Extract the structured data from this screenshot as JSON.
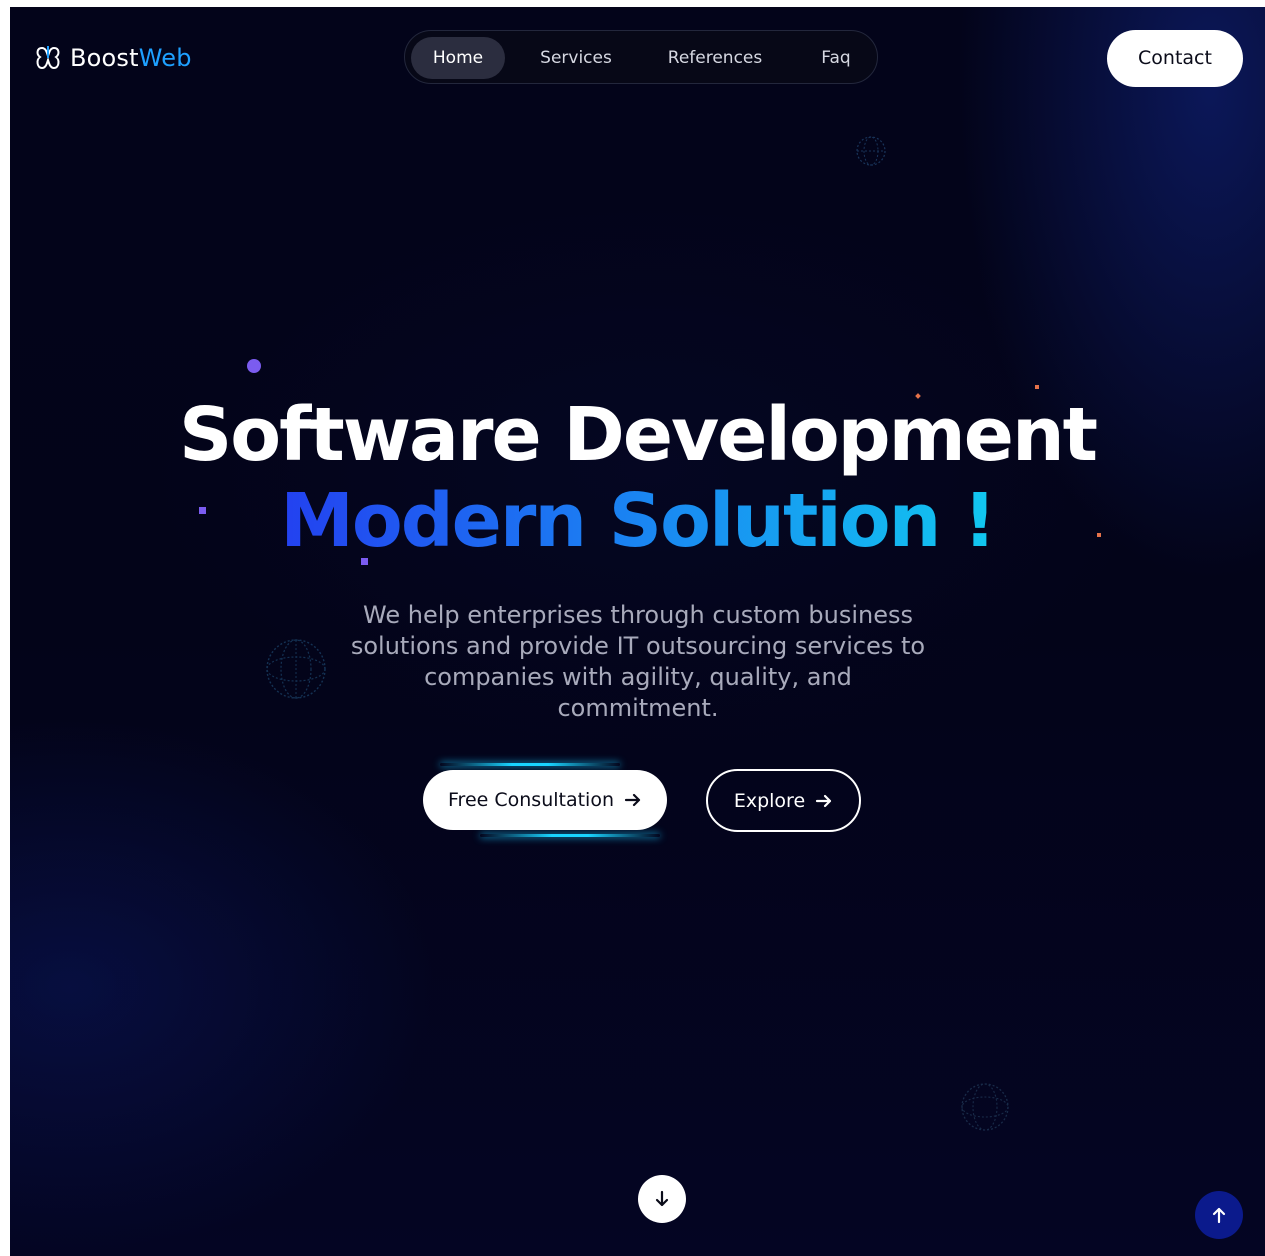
{
  "brand": {
    "name_part1": "Boost",
    "name_part2": "Web",
    "accent_color": "#1ea0ff"
  },
  "nav": {
    "items": [
      {
        "label": "Home",
        "active": true
      },
      {
        "label": "Services",
        "active": false
      },
      {
        "label": "References",
        "active": false
      },
      {
        "label": "Faq",
        "active": false
      }
    ],
    "contact_label": "Contact"
  },
  "hero": {
    "title": "Software Development",
    "subtitle": "Modern Solution !",
    "description": "We help enterprises through custom business solutions and provide IT outsourcing services to companies with agility, quality, and commitment.",
    "primary_button": "Free Consultation",
    "secondary_button": "Explore"
  },
  "icons": {
    "logo": "brand-logo-icon",
    "primary_button_arrow": "arrow-right-icon",
    "secondary_button_arrow": "arrow-right-icon",
    "scroll_down": "arrow-down-icon",
    "scroll_top": "arrow-up-icon",
    "decor": "globe-icon"
  },
  "colors": {
    "background": "#03041a",
    "gradient_start": "#2341f0",
    "gradient_end": "#11c8f0",
    "glow": "#19d3ff",
    "scroll_top_bg": "#0b1a8c"
  }
}
